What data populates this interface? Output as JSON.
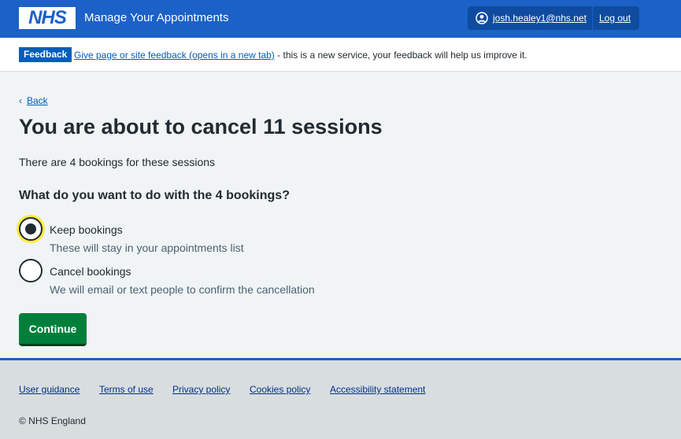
{
  "header": {
    "logo_text": "NHS",
    "service_name": "Manage Your Appointments",
    "user_email": "josh.healey1@nhs.net",
    "logout_label": "Log out",
    "user_icon": "user-circle-icon"
  },
  "feedback": {
    "tag": "Feedback",
    "link_text": "Give page or site feedback (opens in a new tab)",
    "trailing_text": " - this is a new service, your feedback will help us improve it."
  },
  "back": {
    "chevron": "‹",
    "label": "Back"
  },
  "page": {
    "title": "You are about to cancel 11 sessions",
    "intro": "There are 4 bookings for these sessions",
    "question": "What do you want to do with the 4 bookings?",
    "options": [
      {
        "label": "Keep bookings",
        "hint": "These will stay in your appointments list",
        "selected": true
      },
      {
        "label": "Cancel bookings",
        "hint": "We will email or text people to confirm the cancellation",
        "selected": false
      }
    ],
    "continue_label": "Continue"
  },
  "footer": {
    "links": [
      "User guidance",
      "Terms of use",
      "Privacy policy",
      "Cookies policy",
      "Accessibility statement"
    ],
    "copyright": "© NHS England"
  },
  "colors": {
    "header_blue": "#1b61c7",
    "continue_green": "#007f3b",
    "focus_yellow": "#ffeb3b",
    "link_blue": "#005eb8"
  }
}
